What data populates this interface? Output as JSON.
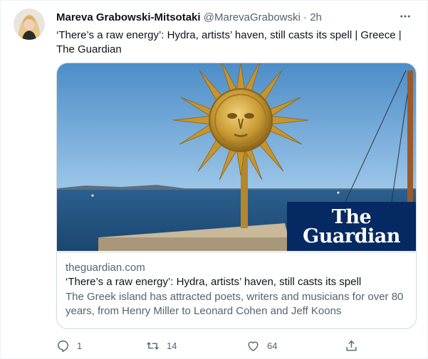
{
  "tweet": {
    "author_name": "Mareva Grabowski-Mitsotaki",
    "author_handle": "@MarevaGrabowski",
    "dot": "·",
    "time": "2h",
    "text": "‘There’s a raw energy’: Hydra, artists’ haven, still casts its spell | Greece | The Guardian"
  },
  "card": {
    "logo_line1": "The",
    "logo_line2": "Guardian",
    "domain": "theguardian.com",
    "title": "‘There’s a raw energy’: Hydra, artists’ haven, still casts its spell",
    "description": "The Greek island has attracted poets, writers and musicians for over 80 years, from Henry Miller to Leonard Cohen and Jeff Koons"
  },
  "actions": {
    "reply_count": "1",
    "retweet_count": "14",
    "like_count": "64"
  },
  "icons": {
    "more": "more-horizontal-icon",
    "reply": "reply-icon",
    "retweet": "retweet-icon",
    "like": "heart-icon",
    "share": "share-icon"
  },
  "colors": {
    "text_primary": "#0f1419",
    "text_secondary": "#536471",
    "border": "#cfd9de",
    "guardian_blue": "#052962"
  }
}
